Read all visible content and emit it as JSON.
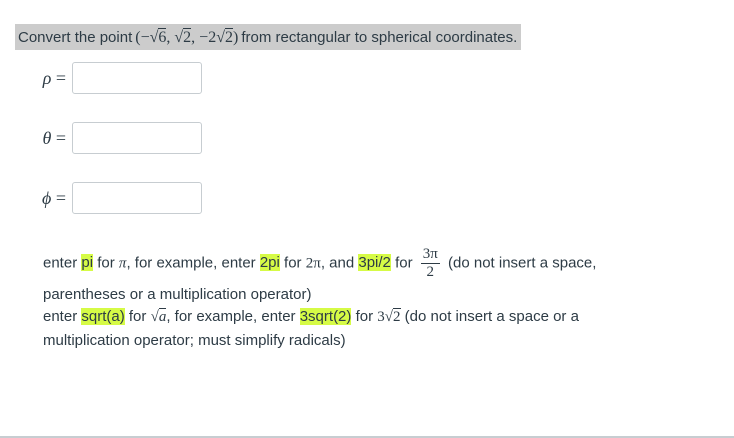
{
  "question": {
    "prefix": "Convert the point",
    "point_open": "(−√",
    "point_a": "6",
    "point_sep1": ", √",
    "point_b": "2",
    "point_sep2": ", −2√",
    "point_c": "2",
    "point_close": ")",
    "suffix": "from rectangular to spherical coordinates."
  },
  "answers": [
    {
      "symbol": "ρ",
      "equals": "=",
      "value": ""
    },
    {
      "symbol": "θ",
      "equals": "=",
      "value": ""
    },
    {
      "symbol": "ϕ",
      "equals": "=",
      "value": ""
    }
  ],
  "hint_pi": {
    "t1": "enter",
    "code_pi": "pi",
    "t2": "for",
    "sym_pi": "π",
    "t3": ", for example, enter",
    "code_2pi": "2pi",
    "t4": "for",
    "sym_2pi": "2π",
    "t5": ", and",
    "code_3pi2": "3pi/2",
    "t6": "for",
    "frac_num": "3π",
    "frac_den": "2",
    "t7": "(do not insert a space,",
    "t8": "parentheses or a multiplication operator)"
  },
  "hint_sqrt": {
    "t1": "enter",
    "code_sqrt": "sqrt(a)",
    "t2": "for",
    "sym_sqrt_prefix": "√",
    "sym_sqrt_arg": "a",
    "t3": ", for example, enter",
    "code_3sqrt2": "3sqrt(2)",
    "t4": "for",
    "sym_3sqrt2_prefix": "3√",
    "sym_3sqrt2_arg": "2",
    "t5": "(do not insert a space or a",
    "t6": "multiplication operator; must simplify radicals)"
  },
  "colors": {
    "highlight": "#d6fb46",
    "question_bg": "#cccccc",
    "text": "#2d3b45"
  }
}
